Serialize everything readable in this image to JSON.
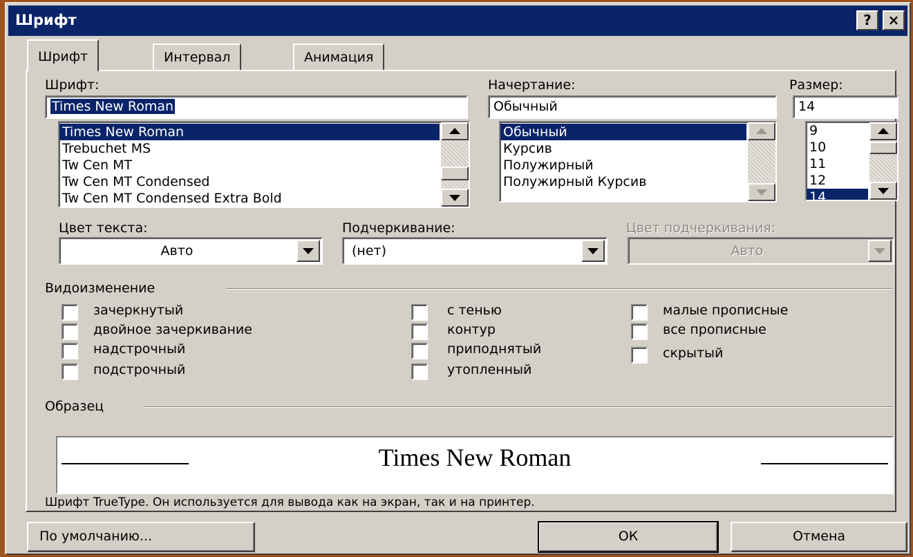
{
  "window": {
    "title": "Шрифт",
    "help_label": "?",
    "close_label": "×"
  },
  "tabs": [
    {
      "label": "Шрифт",
      "active": true
    },
    {
      "label": "Интервал",
      "active": false
    },
    {
      "label": "Анимация",
      "active": false
    }
  ],
  "font": {
    "label": "Шрифт:",
    "value": "Times New Roman",
    "list": [
      "Times New Roman",
      "Trebuchet MS",
      "Tw Cen MT",
      "Tw Cen MT Condensed",
      "Tw Cen MT Condensed Extra Bold"
    ],
    "selected_index": 0
  },
  "style": {
    "label": "Начертание:",
    "value": "Обычный",
    "list": [
      "Обычный",
      "Курсив",
      "Полужирный",
      "Полужирный Курсив"
    ],
    "selected_index": 0
  },
  "size": {
    "label": "Размер:",
    "value": "14",
    "list": [
      "9",
      "10",
      "11",
      "12",
      "14"
    ],
    "selected_index": 4
  },
  "text_color": {
    "label": "Цвет текста:",
    "value": "Авто"
  },
  "underline": {
    "label": "Подчеркивание:",
    "value": "(нет)"
  },
  "underline_color": {
    "label": "Цвет подчеркивания:",
    "value": "Авто",
    "enabled": false
  },
  "effects": {
    "label": "Видоизменение",
    "col1": [
      {
        "label": "зачеркнутый",
        "checked": false
      },
      {
        "label": "двойное зачеркивание",
        "checked": false
      },
      {
        "label": "надстрочный",
        "checked": false
      },
      {
        "label": "подстрочный",
        "checked": false
      }
    ],
    "col2": [
      {
        "label": "с тенью",
        "checked": false
      },
      {
        "label": "контур",
        "checked": false
      },
      {
        "label": "приподнятый",
        "checked": false
      },
      {
        "label": "утопленный",
        "checked": false
      }
    ],
    "col3": [
      {
        "label": "малые прописные",
        "checked": false
      },
      {
        "label": "все прописные",
        "checked": false
      },
      {
        "label": "скрытый",
        "checked": false
      }
    ]
  },
  "sample": {
    "label": "Образец",
    "text": "Times New Roman",
    "description": "Шрифт TrueType. Он используется для вывода как на экран, так и на принтер."
  },
  "buttons": {
    "default_label": "По умолчанию...",
    "ok_label": "ОК",
    "cancel_label": "Отмена"
  },
  "colors": {
    "desktop": "#a0521e",
    "titlebar": "#0a246a",
    "face": "#d4d0c8",
    "selection": "#0a246a"
  }
}
